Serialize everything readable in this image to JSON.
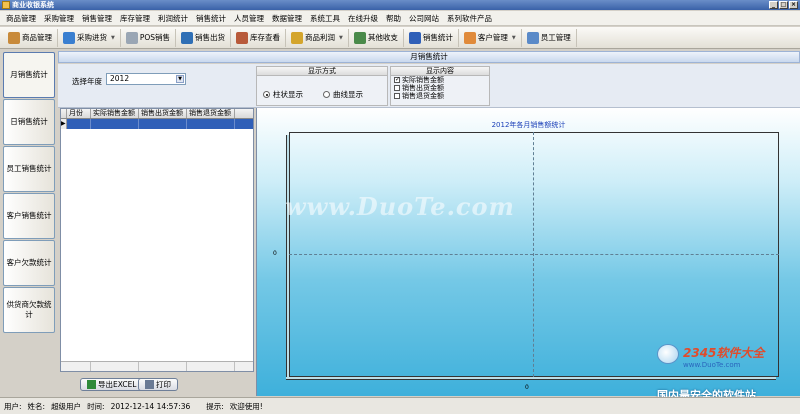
{
  "window": {
    "title": "商业收银系统"
  },
  "menu": [
    "商品管理",
    "采购管理",
    "销售管理",
    "库存管理",
    "利润统计",
    "销售统计",
    "人员管理",
    "数据管理",
    "系统工具",
    "在线升级",
    "帮助",
    "公司网站",
    "系列软件产品"
  ],
  "toolbar": [
    {
      "label": "商品管理",
      "icon": "box-icon",
      "dropdown": false
    },
    {
      "label": "采购进货",
      "icon": "cart-icon",
      "dropdown": true
    },
    {
      "label": "POS销售",
      "icon": "pos-icon",
      "dropdown": false
    },
    {
      "label": "销售出货",
      "icon": "truck-icon",
      "dropdown": false
    },
    {
      "label": "库存查看",
      "icon": "warehouse-icon",
      "dropdown": false
    },
    {
      "label": "商品利润",
      "icon": "money-icon",
      "dropdown": true
    },
    {
      "label": "其他收支",
      "icon": "ledger-icon",
      "dropdown": false
    },
    {
      "label": "销售统计",
      "icon": "chart-icon",
      "dropdown": false
    },
    {
      "label": "客户管理",
      "icon": "customer-icon",
      "dropdown": true
    },
    {
      "label": "员工管理",
      "icon": "staff-icon",
      "dropdown": false
    }
  ],
  "leftnav": [
    "月销售统计",
    "日销售统计",
    "员工销售统计",
    "客户销售统计",
    "客户欠款统计",
    "供货商欠款统计"
  ],
  "panel": {
    "title": "月销售统计"
  },
  "options": {
    "year_label": "选择年度",
    "year_value": "2012",
    "display_mode": {
      "title": "显示方式",
      "bar": "柱状显示",
      "line": "曲线显示",
      "selected": "bar"
    },
    "display_content": {
      "title": "显示内容",
      "items": [
        {
          "label": "实际销售金额",
          "checked": true
        },
        {
          "label": "销售出货金额",
          "checked": false
        },
        {
          "label": "销售退货金额",
          "checked": false
        }
      ]
    }
  },
  "grid": {
    "columns": [
      "月份",
      "实际销售金额",
      "销售出货金额",
      "销售退货金额"
    ]
  },
  "buttons": {
    "export": "导出EXCEL",
    "print": "打印"
  },
  "chart_data": {
    "type": "bar",
    "title": "2012年各月销售额统计",
    "categories": [],
    "series": [],
    "y_ticks": [
      "0"
    ],
    "x_ticks": [
      "0"
    ],
    "grid": true
  },
  "watermark": {
    "text": "www.DuoTe.com",
    "brand": "2345软件大全",
    "site": "www.DuoTe.com",
    "tagline": "国内最安全的软件站"
  },
  "status": {
    "user_label": "用户:",
    "name_label": "姓名:",
    "name": "超级用户",
    "time_label": "时间:",
    "time": "2012-12-14 14:57:36",
    "hint_label": "提示:",
    "hint": "欢迎使用!"
  },
  "colors": {
    "selection": "#2f5fb8",
    "chart_title": "#1a3fb8"
  }
}
